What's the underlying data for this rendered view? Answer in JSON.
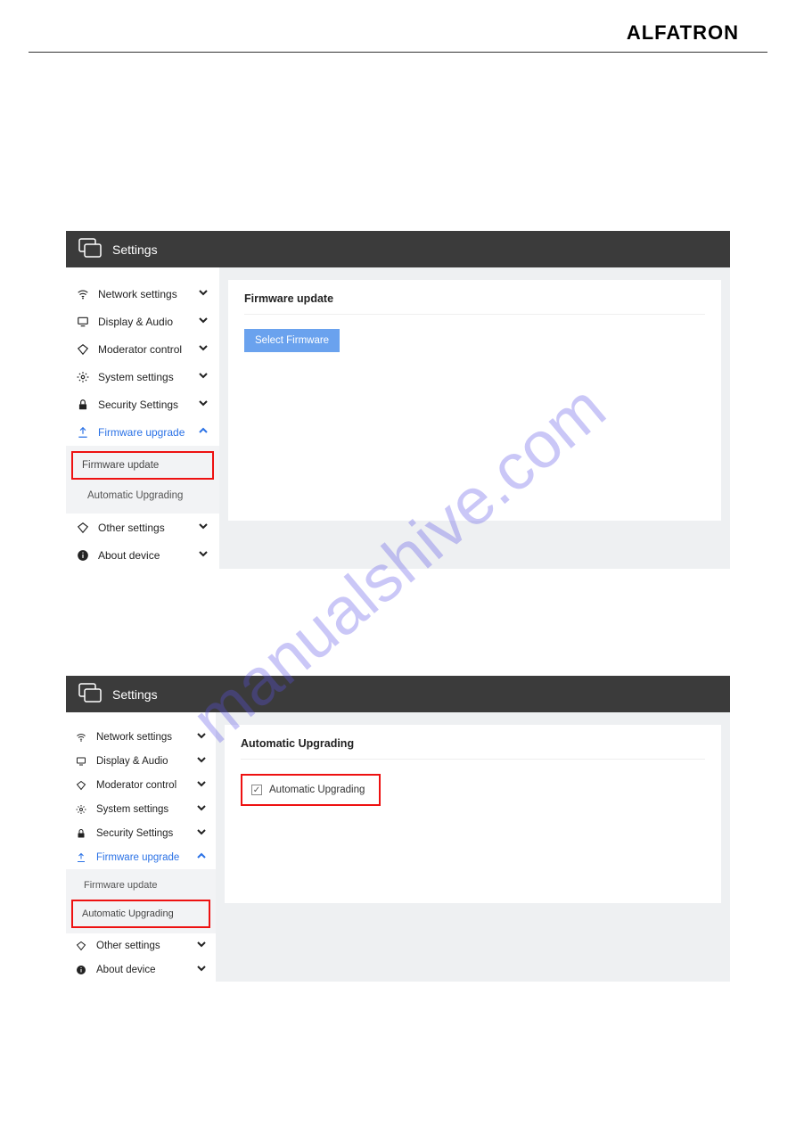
{
  "brand": "ALFATRON",
  "watermark": "manualshive.com",
  "header_title": "Settings",
  "sidebar": {
    "items": [
      {
        "label": "Network settings",
        "icon": "wifi-icon",
        "expanded": false
      },
      {
        "label": "Display & Audio",
        "icon": "monitor-icon",
        "expanded": false
      },
      {
        "label": "Moderator control",
        "icon": "diamond-icon",
        "expanded": false
      },
      {
        "label": "System settings",
        "icon": "gear-icon",
        "expanded": false
      },
      {
        "label": "Security Settings",
        "icon": "lock-icon",
        "expanded": false
      },
      {
        "label": "Firmware upgrade",
        "icon": "upload-icon",
        "expanded": true,
        "active": true,
        "sub": [
          {
            "label": "Firmware update"
          },
          {
            "label": "Automatic Upgrading"
          }
        ]
      },
      {
        "label": "Other settings",
        "icon": "diamond-icon",
        "expanded": false
      },
      {
        "label": "About device",
        "icon": "info-icon",
        "expanded": false
      }
    ]
  },
  "panel1": {
    "content_title": "Firmware update",
    "button_label": "Select Firmware",
    "highlighted_sub": "Firmware update"
  },
  "panel2": {
    "content_title": "Automatic Upgrading",
    "checkbox_label": "Automatic Upgrading",
    "highlighted_sub": "Automatic Upgrading"
  }
}
